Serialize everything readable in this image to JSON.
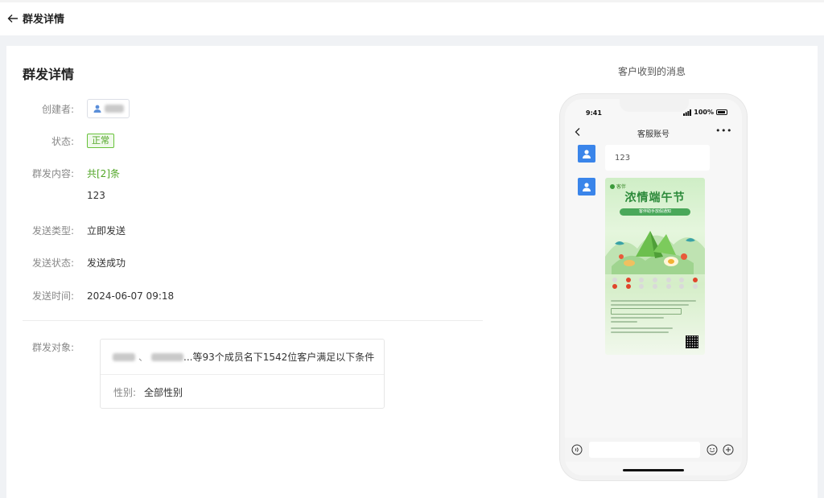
{
  "header": {
    "title": "群发详情"
  },
  "detail": {
    "title": "群发详情",
    "fields": {
      "creator_label": "创建者:",
      "status_label": "状态:",
      "status_value": "正常",
      "content_label": "群发内容:",
      "content_count": "共[2]条",
      "content_text": "123",
      "send_type_label": "发送类型:",
      "send_type_value": "立即发送",
      "send_status_label": "发送状态:",
      "send_status_value": "发送成功",
      "send_time_label": "发送时间:",
      "send_time_value": "2024-06-07 09:18"
    },
    "target": {
      "label": "群发对象:",
      "separator": "、",
      "summary": "...等93个成员名下1542位客户满足以下条件",
      "condition_key": "性别:",
      "condition_value": "全部性别"
    }
  },
  "preview": {
    "label": "客户收到的消息",
    "status_time": "9:41",
    "battery": "100%",
    "chat_title": "客服账号",
    "more": "•••",
    "message_text": "123",
    "poster": {
      "badge": "客伴",
      "title": "浓情端午节",
      "subtitle": "客伴助手放假通知"
    }
  },
  "colors": {
    "accent_green": "#52a627",
    "avatar_blue": "#3a85ea"
  }
}
